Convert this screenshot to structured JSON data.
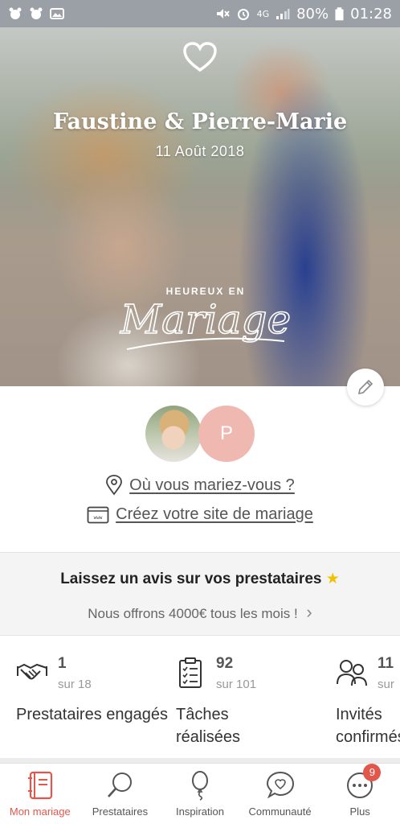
{
  "status_bar": {
    "battery": "80%",
    "time": "01:28",
    "network": "4G",
    "icons_left": [
      "notification-icon",
      "notification-icon",
      "image-icon"
    ],
    "icons_right": [
      "mute-icon",
      "alarm-icon",
      "signal-icon",
      "battery-icon"
    ]
  },
  "hero": {
    "title": "Faustine & Pierre-Marie",
    "date": "11 Août 2018",
    "stamp_top": "HEUREUX EN",
    "stamp_main": "Mariage"
  },
  "profile": {
    "partner_initial": "P",
    "location_link": "Où vous mariez-vous ?",
    "website_link": "Créez votre site de mariage"
  },
  "review_banner": {
    "title": "Laissez un avis sur vos prestataires",
    "star": "★",
    "subtitle": "Nous offrons 4000€ tous les mois !",
    "chevron": "›"
  },
  "stats": [
    {
      "icon": "handshake-icon",
      "value": "1",
      "total": "sur 18",
      "label": "Prestataires engagés"
    },
    {
      "icon": "checklist-icon",
      "value": "92",
      "total": "sur 101",
      "label": "Tâches réalisées"
    },
    {
      "icon": "guests-icon",
      "value": "11",
      "total": "sur",
      "label": "Invités confirmés"
    }
  ],
  "bottom_nav": [
    {
      "label": "Mon mariage",
      "icon": "notebook-icon",
      "active": true
    },
    {
      "label": "Prestataires",
      "icon": "search-icon",
      "active": false
    },
    {
      "label": "Inspiration",
      "icon": "balloon-icon",
      "active": false
    },
    {
      "label": "Communauté",
      "icon": "chat-heart-icon",
      "active": false
    },
    {
      "label": "Plus",
      "icon": "more-icon",
      "active": false,
      "badge": "9"
    }
  ],
  "colors": {
    "accent": "#e2574c",
    "partner_avatar": "#efb9b1",
    "star": "#f2c200"
  }
}
